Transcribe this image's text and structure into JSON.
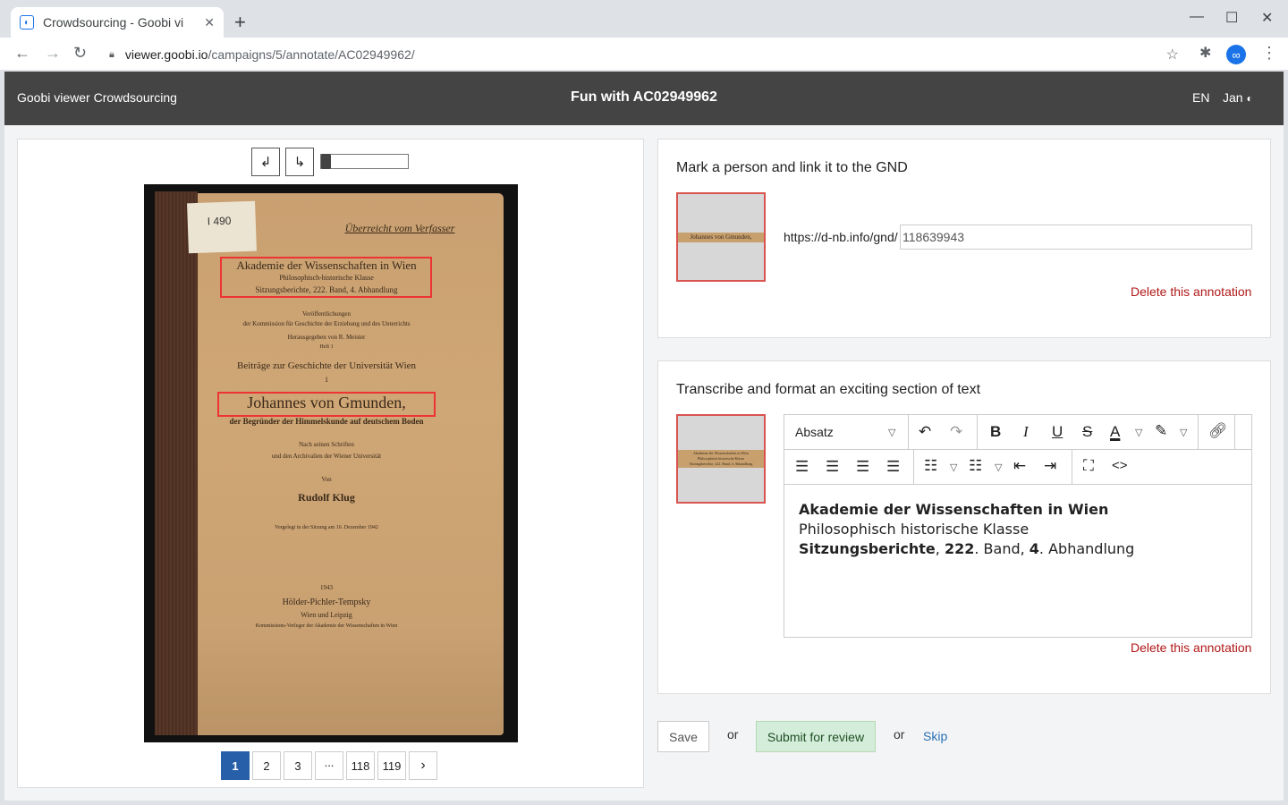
{
  "browser": {
    "tab_title": "Crowdsourcing - Goobi vi",
    "new_tab": "+",
    "url_host": "viewer.goobi.io",
    "url_path": "/campaigns/5/annotate/AC02949962/"
  },
  "header": {
    "brand": "Goobi viewer Crowdsourcing",
    "title": "Fun with AC02949962",
    "language": "EN",
    "user": "Jan"
  },
  "scan": {
    "label": "I 490",
    "lines": {
      "inscription": "Überreicht vom Verfasser",
      "academy": "Akademie der Wissenschaften in Wien",
      "class": "Philosophisch-historische Klasse",
      "reports": "Sitzungsberichte, 222. Band, 4. Abhandlung",
      "publ1": "Veröffentlichungen",
      "publ2": "der Kommission für Geschichte der Erziehung und des Unterrichts",
      "publ3": "Herausgegeben von R. Meister",
      "publ4": "Heft 1",
      "series": "Beiträge zur Geschichte der Universität Wien",
      "series_no": "1",
      "name": "Johannes von Gmunden,",
      "subtitle": "der Begründer der Himmelskunde auf deutschem Boden",
      "src1": "Nach seinen Schriften",
      "src2": "und den Archivalien der Wiener Universität",
      "by": "Von",
      "author": "Rudolf Klug",
      "presented": "Vorgelegt in der Sitzung am 16. Dezember 1942",
      "year": "1943",
      "publisher": "Hölder-Pichler-Tempsky",
      "cities": "Wien und Leipzig",
      "imprint": "Kommissions-Verleger der Akademie der Wissenschaften in Wien"
    }
  },
  "pagination": [
    "1",
    "2",
    "3",
    "...",
    "118",
    "119"
  ],
  "pagination_next": "›",
  "tasks": {
    "person": {
      "question": "Mark a person and link it to the GND",
      "thumb_text": "Johannes von Gmunden,",
      "gnd_prefix": "https://d-nb.info/gnd/",
      "gnd_value": "118639943",
      "delete": "Delete this annotation"
    },
    "transcribe": {
      "question": "Transcribe and format an exciting section of text",
      "thumb_l1": "Akademie der Wissenschaften in Wien",
      "thumb_l2": "Philosophisch historische Klasse",
      "thumb_l3": "Sitzungsberichte, 222. Band, 4. Abhandlung",
      "format": "Absatz",
      "line1": "Akademie der Wissenschaften in Wien",
      "line2": "Philosophisch historische Klasse",
      "line3_a": "Sitzungsberichte",
      "line3_b": ", ",
      "line3_c": "222",
      "line3_d": ". Band, ",
      "line3_e": "4",
      "line3_f": ". Abhandlung",
      "delete": "Delete this annotation"
    }
  },
  "actions": {
    "save": "Save",
    "or": "or",
    "submit": "Submit for review",
    "skip": "Skip"
  }
}
